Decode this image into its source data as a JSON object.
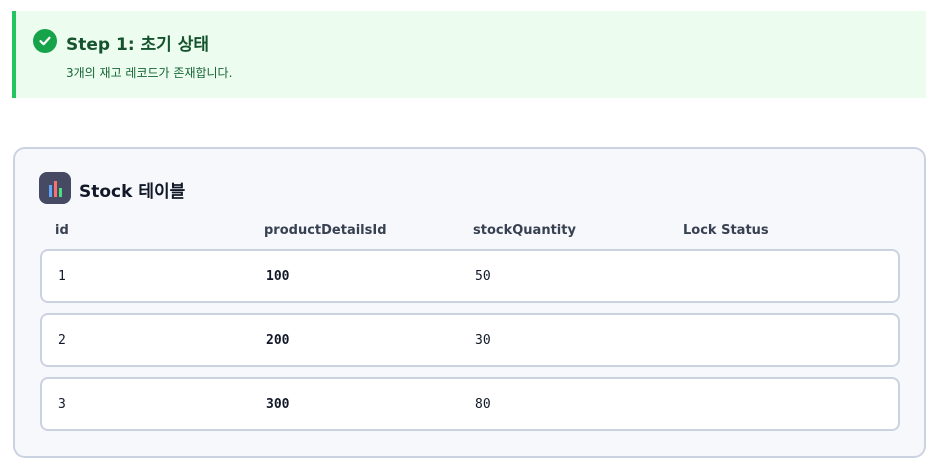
{
  "step": {
    "title": "Step 1: 초기 상태",
    "description": "3개의 재고 레코드가 존재합니다.",
    "accent_color": "#22c55e",
    "icon": "check-circle-icon"
  },
  "table": {
    "icon": "bar-chart-icon",
    "title": "Stock 테이블",
    "columns": [
      "id",
      "productDetailsId",
      "stockQuantity",
      "Lock Status"
    ],
    "rows": [
      {
        "id": "1",
        "productDetailsId": "100",
        "stockQuantity": "50",
        "lockStatus": ""
      },
      {
        "id": "2",
        "productDetailsId": "200",
        "stockQuantity": "30",
        "lockStatus": ""
      },
      {
        "id": "3",
        "productDetailsId": "300",
        "stockQuantity": "80",
        "lockStatus": ""
      }
    ]
  }
}
